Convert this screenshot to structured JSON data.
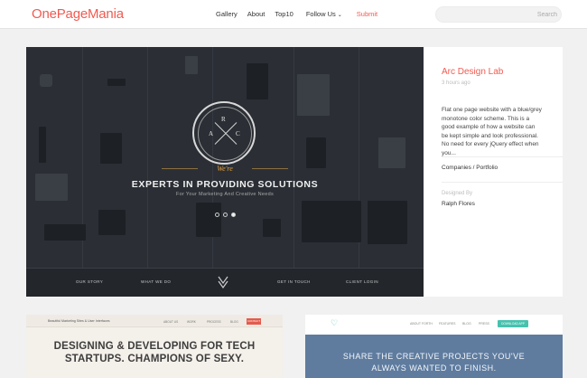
{
  "header": {
    "logo": "OnePageMania",
    "nav": [
      "Gallery",
      "About",
      "Top10",
      "Follow Us",
      "Submit"
    ],
    "search_placeholder": "Search"
  },
  "featured": {
    "hero": {
      "emblem_letters": [
        "R",
        "A",
        "C"
      ],
      "tagline_small": "We're",
      "tagline_big": "EXPERTS IN PROVIDING SOLUTIONS",
      "tagline_sub": "For Your Marketing And Creative Needs",
      "bar_links": [
        "OUR STORY",
        "WHAT WE DO",
        "GET IN TOUCH",
        "CLIENT LOGIN"
      ]
    },
    "title": "Arc Design Lab",
    "time": "3 hours ago",
    "description": "Flat one page website with a blue/grey monotone color scheme. This is a good example of how a website can be kept simple and look professional. No need for every jQuery effect when you...",
    "category": "Companies / Portfolio",
    "designed_by_label": "Designed By",
    "designer": "Ralph Flores"
  },
  "cards": [
    {
      "brand": "Beautiful Marketing Sites & User Interfaces",
      "links": [
        "ABOUT US",
        "WORK",
        "PROCESS",
        "BLOG"
      ],
      "button": "CONTACT",
      "headline_lines": [
        "DESIGNING & DEVELOPING FOR TECH",
        "STARTUPS. CHAMPIONS OF SEXY."
      ]
    },
    {
      "links": [
        "ABOUT FORTH",
        "FEATURES",
        "BLOG",
        "PRESS"
      ],
      "button": "DOWNLOAD APP",
      "headline_lines": [
        "SHARE THE CREATIVE PROJECTS YOU'VE",
        "ALWAYS WANTED TO FINISH."
      ]
    }
  ]
}
